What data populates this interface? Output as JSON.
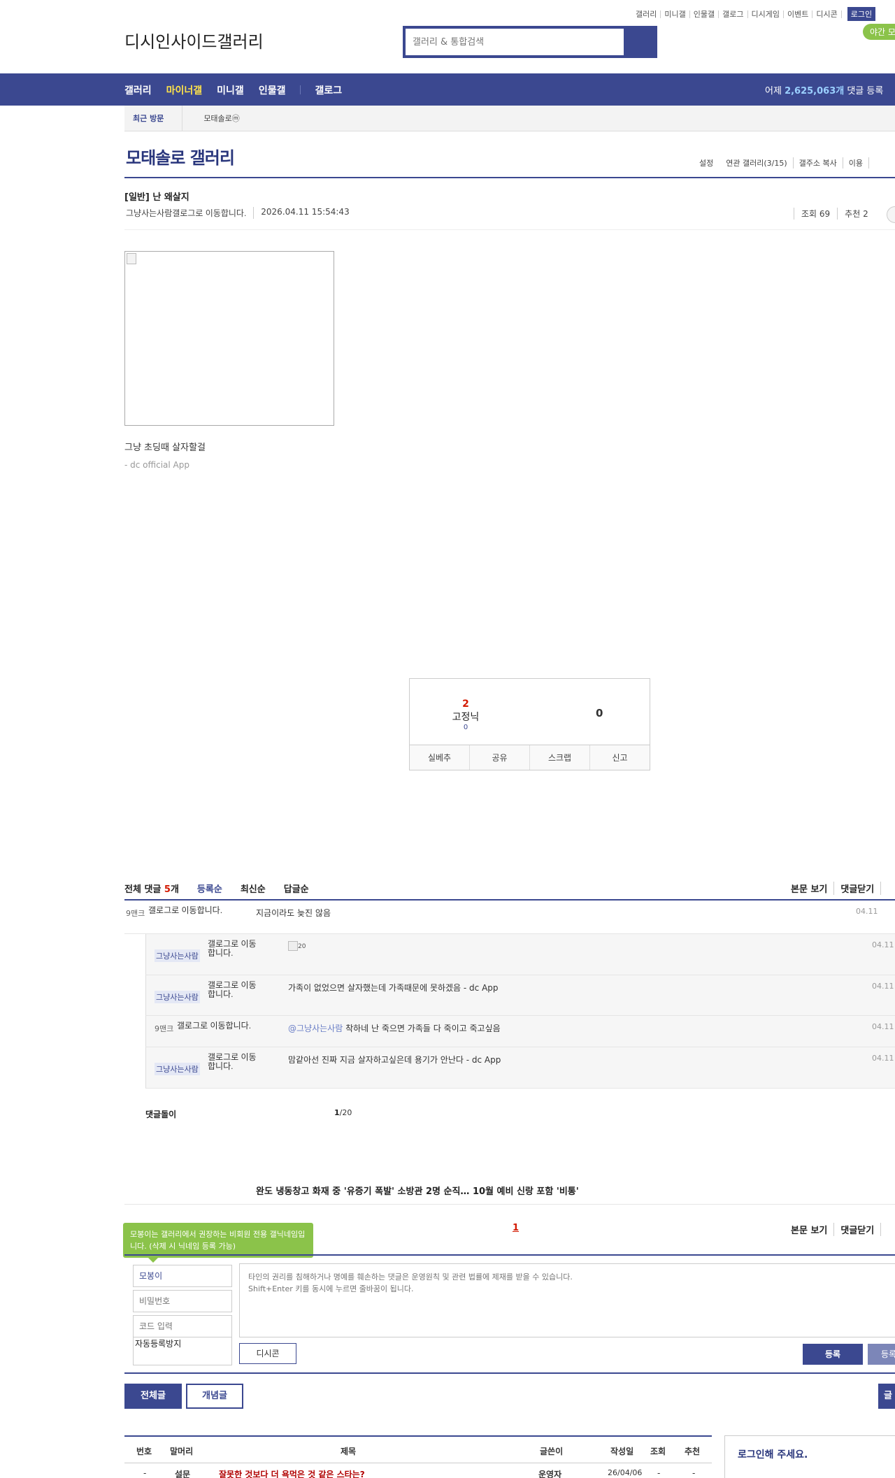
{
  "util_links": [
    "갤러리",
    "미니갤",
    "인물갤",
    "갤로그",
    "디시게임",
    "이벤트",
    "디시콘"
  ],
  "login_label": "로그인",
  "night_mode_label": "야간 모드",
  "logo_alt": "디시인사이드갤러리",
  "search": {
    "placeholder": "갤러리 & 통합검색"
  },
  "nav": {
    "items": [
      "갤러리",
      "마이너갤",
      "미니갤",
      "인물갤",
      "갤로그"
    ],
    "active": "마이너갤"
  },
  "stat": {
    "prefix": "어제 ",
    "count": "2,625,063개",
    "suffix": " 댓글 등록"
  },
  "visit": {
    "label": "최근 방문",
    "item": "모태솔로ⓜ"
  },
  "gallery": {
    "title": "모태솔로 갤러리",
    "options": [
      "설정",
      "연관 갤러리(3/15)",
      "갤주소 복사",
      "이용"
    ]
  },
  "post": {
    "title": "[일반] 난 왜살지",
    "author": "그냥사는사람",
    "author_icon_alt": "갤로그로 이동합니다.",
    "date": "2026.04.11 15:54:43",
    "views": "조회 69",
    "recommend": "추천 2",
    "body": "그냥 초딩때 살자할걸",
    "app_sign": "- dc official App"
  },
  "vote": {
    "up_count": "2",
    "fixed_nick_alt": "고정닉",
    "fixed_count": "0",
    "down_count": "0",
    "buttons": [
      "실베추",
      "공유",
      "스크랩",
      "신고"
    ]
  },
  "comments_header": {
    "total_prefix": "전체 댓글 ",
    "total_count": "5",
    "total_suffix": "개",
    "sorts": [
      "등록순",
      "최신순",
      "답글순"
    ],
    "right": [
      "본문 보기",
      "댓글닫기"
    ]
  },
  "comments": [
    {
      "nick": "9맨크",
      "galog_alt": "갤로그로 이동합니다.",
      "text": "지금이라도 늦진 않음",
      "date": "04.11"
    },
    {
      "nick": "그냥사는사람",
      "galog_alt": "갤로그로 이동합니다.",
      "text": "",
      "dccon_alt": "20",
      "date": "04.11"
    },
    {
      "nick": "그냥사는사람",
      "galog_alt": "갤로그로 이동합니다.",
      "text": "가족이 없었으면 살자했는데 가족때문에 못하겠음 - dc App",
      "date": "04.11"
    },
    {
      "nick": "9맨크",
      "galog_alt": "갤로그로 이동합니다.",
      "mention": "@그냥사는사람",
      "text": " 착하네 난 죽으면 가족들 다 죽이고 죽고싶음",
      "date": "04.11"
    },
    {
      "nick": "그냥사는사람",
      "galog_alt": "갤로그로 이동합니다.",
      "text": "맘같아선 진짜 지금 살자하고싶은데 용기가 안난다 - dc App",
      "date": "04.11"
    }
  ],
  "comment_footer": {
    "label": "댓글돌이",
    "page_current": "1",
    "page_total": "/20"
  },
  "news": "완도 냉동창고 화재 중 '유증기 폭발' 소방관 2명 순직… 10월 예비 신랑 포함 '비통'",
  "write": {
    "tooltip": "모봉이는 갤러리에서 권장하는 비회원 전용 갤닉네임입니다. (삭제 시 닉네임 등록 가능)",
    "page": "1",
    "nick_value": "모봉이",
    "password_placeholder": "비밀번호",
    "code_placeholder": "코드 입력",
    "captcha_alt": "자동등록방지",
    "textarea_placeholder": "타인의 권리를 침해하거나 명예를 훼손하는 댓글은 운영원칙 및 관련 법률에 제재를 받을 수 있습니다.\nShift+Enter 키를 동시에 누르면 줄바꿈이 됩니다.",
    "dccon_label": "디시콘",
    "submit_label": "등록",
    "submit2_label": "등록"
  },
  "tabs": {
    "all": "전체글",
    "best": "개념글",
    "write": "글쓰기"
  },
  "list": {
    "headers": [
      "번호",
      "말머리",
      "제목",
      "글쓴이",
      "작성일",
      "조회",
      "추천"
    ],
    "rows": [
      {
        "num": "-",
        "head": "설문",
        "title": "잘못한 것보다 더 욕먹은 것 같은 스타는?",
        "writer": "운영자",
        "date": "26/04/06",
        "views": "-",
        "rec": "-"
      }
    ]
  },
  "side": {
    "login_prompt": "로그인해 주세요."
  }
}
